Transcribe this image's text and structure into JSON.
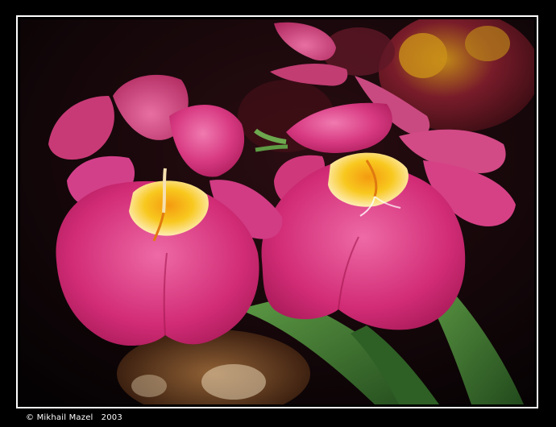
{
  "caption": {
    "copyright_symbol": "©",
    "author": "Mikhail Mazel",
    "year": "2003"
  },
  "colors": {
    "background": "#000000",
    "frame_border": "#ffffff",
    "petal_magenta": "#d62a78",
    "petal_pink": "#e85a9a",
    "flower_center": "#f5c21a",
    "leaf_green": "#3f7a33"
  },
  "icons": {
    "copyright": "copyright-icon"
  }
}
